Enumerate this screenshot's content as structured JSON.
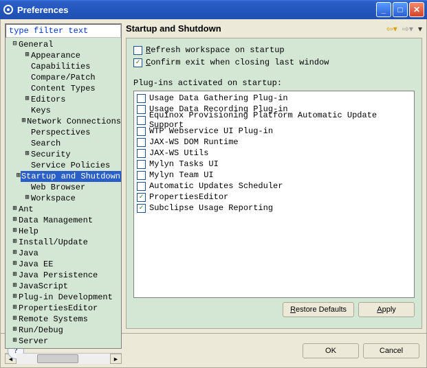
{
  "title": "Preferences",
  "filter_placeholder": "type filter text",
  "page_title": "Startup and Shutdown",
  "tree": [
    {
      "depth": 0,
      "glyph": "-",
      "label": "General"
    },
    {
      "depth": 1,
      "glyph": "+",
      "label": "Appearance"
    },
    {
      "depth": 1,
      "glyph": "",
      "label": "Capabilities"
    },
    {
      "depth": 1,
      "glyph": "",
      "label": "Compare/Patch"
    },
    {
      "depth": 1,
      "glyph": "",
      "label": "Content Types"
    },
    {
      "depth": 1,
      "glyph": "+",
      "label": "Editors"
    },
    {
      "depth": 1,
      "glyph": "",
      "label": "Keys"
    },
    {
      "depth": 1,
      "glyph": "+",
      "label": "Network Connections"
    },
    {
      "depth": 1,
      "glyph": "",
      "label": "Perspectives"
    },
    {
      "depth": 1,
      "glyph": "",
      "label": "Search"
    },
    {
      "depth": 1,
      "glyph": "+",
      "label": "Security"
    },
    {
      "depth": 1,
      "glyph": "",
      "label": "Service Policies"
    },
    {
      "depth": 1,
      "glyph": "+",
      "label": "Startup and Shutdown",
      "selected": true
    },
    {
      "depth": 1,
      "glyph": "",
      "label": "Web Browser"
    },
    {
      "depth": 1,
      "glyph": "+",
      "label": "Workspace"
    },
    {
      "depth": 0,
      "glyph": "+",
      "label": "Ant"
    },
    {
      "depth": 0,
      "glyph": "+",
      "label": "Data Management"
    },
    {
      "depth": 0,
      "glyph": "+",
      "label": "Help"
    },
    {
      "depth": 0,
      "glyph": "+",
      "label": "Install/Update"
    },
    {
      "depth": 0,
      "glyph": "+",
      "label": "Java"
    },
    {
      "depth": 0,
      "glyph": "+",
      "label": "Java EE"
    },
    {
      "depth": 0,
      "glyph": "+",
      "label": "Java Persistence"
    },
    {
      "depth": 0,
      "glyph": "+",
      "label": "JavaScript"
    },
    {
      "depth": 0,
      "glyph": "+",
      "label": "Plug-in Development"
    },
    {
      "depth": 0,
      "glyph": "+",
      "label": "PropertiesEditor"
    },
    {
      "depth": 0,
      "glyph": "+",
      "label": "Remote Systems"
    },
    {
      "depth": 0,
      "glyph": "+",
      "label": "Run/Debug"
    },
    {
      "depth": 0,
      "glyph": "+",
      "label": "Server"
    }
  ],
  "options": {
    "refresh": {
      "label": "Refresh workspace on startup",
      "checked": false
    },
    "confirm": {
      "label": "Confirm exit when closing last window",
      "checked": true
    }
  },
  "plugins_label": "Plug-ins activated on startup:",
  "plugins": [
    {
      "label": "Usage Data Gathering Plug-in",
      "checked": false
    },
    {
      "label": "Usage Data Recording Plug-in",
      "checked": false
    },
    {
      "label": "Equinox Provisioning Platform Automatic Update Support",
      "checked": false
    },
    {
      "label": "WTP Webservice UI Plug-in",
      "checked": false
    },
    {
      "label": "JAX-WS DOM Runtime",
      "checked": false
    },
    {
      "label": "JAX-WS Utils",
      "checked": false
    },
    {
      "label": "Mylyn Tasks UI",
      "checked": false
    },
    {
      "label": "Mylyn Team UI",
      "checked": false
    },
    {
      "label": "Automatic Updates Scheduler",
      "checked": false
    },
    {
      "label": "PropertiesEditor",
      "checked": true
    },
    {
      "label": "Subclipse Usage Reporting",
      "checked": true
    }
  ],
  "buttons": {
    "restore": "Restore Defaults",
    "apply": "Apply",
    "ok": "OK",
    "cancel": "Cancel"
  }
}
